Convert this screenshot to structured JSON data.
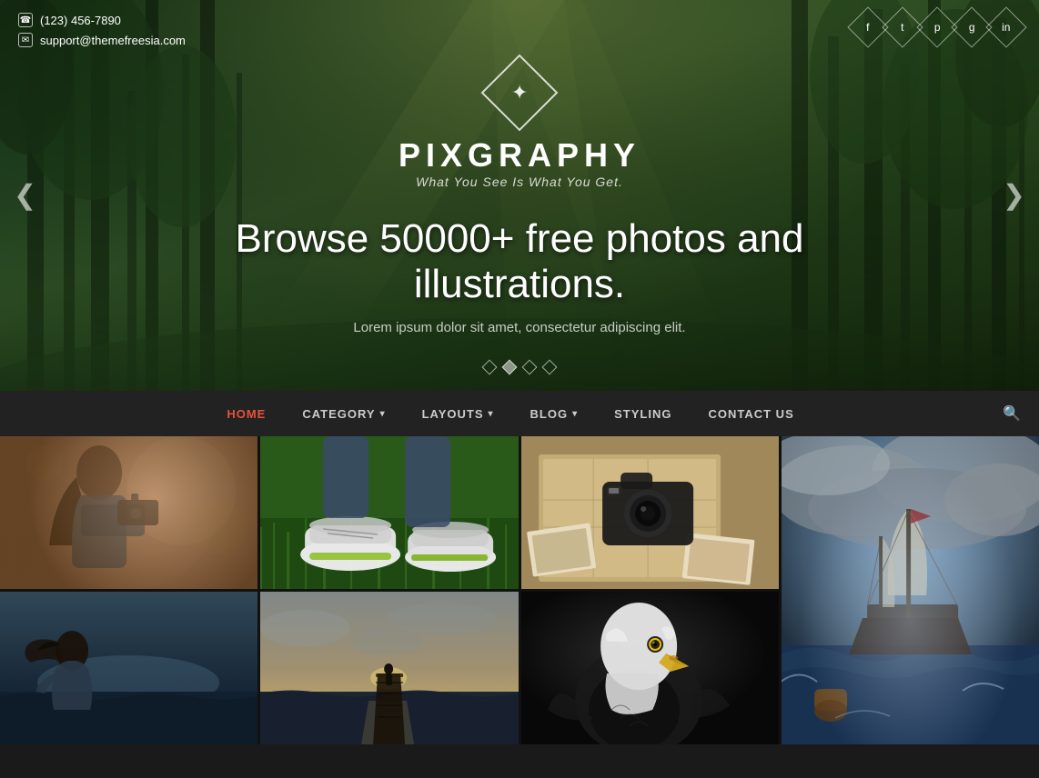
{
  "site": {
    "name": "PIXGRAPHY",
    "tagline": "What You See Is What You Get.",
    "logo_symbol": "✦"
  },
  "topbar": {
    "phone": "(123) 456-7890",
    "email": "support@themefreesia.com",
    "phone_icon": "☎",
    "email_icon": "✉"
  },
  "social": {
    "icons": [
      "f",
      "t",
      "p",
      "g+",
      "in"
    ]
  },
  "hero": {
    "headline": "Browse 50000+ free photos and illustrations.",
    "subtext": "Lorem ipsum dolor sit amet, consectetur adipiscing elit.",
    "prev_arrow": "❮",
    "next_arrow": "❯"
  },
  "nav": {
    "items": [
      {
        "label": "HOME",
        "active": true,
        "has_dropdown": false
      },
      {
        "label": "CATEGORY",
        "active": false,
        "has_dropdown": true
      },
      {
        "label": "LAYOUTS",
        "active": false,
        "has_dropdown": true
      },
      {
        "label": "BLOG",
        "active": false,
        "has_dropdown": true
      },
      {
        "label": "STYLING",
        "active": false,
        "has_dropdown": false
      },
      {
        "label": "CONTACT US",
        "active": false,
        "has_dropdown": false
      }
    ],
    "search_icon": "🔍"
  },
  "photos": [
    {
      "id": "photo-1",
      "alt": "Photographer with camera"
    },
    {
      "id": "photo-2",
      "alt": "Colorful sneakers on grass"
    },
    {
      "id": "photo-3",
      "alt": "Camera on map with photos"
    },
    {
      "id": "photo-4",
      "alt": "Tall ship in stormy sea",
      "tall": true
    },
    {
      "id": "photo-5",
      "alt": "Woman looking at sea"
    },
    {
      "id": "photo-6",
      "alt": "Person on pier at sunset"
    },
    {
      "id": "photo-7",
      "alt": "Bald eagle portrait"
    }
  ],
  "slider_dots": [
    {
      "active": false
    },
    {
      "active": true
    },
    {
      "active": false
    },
    {
      "active": false
    }
  ]
}
